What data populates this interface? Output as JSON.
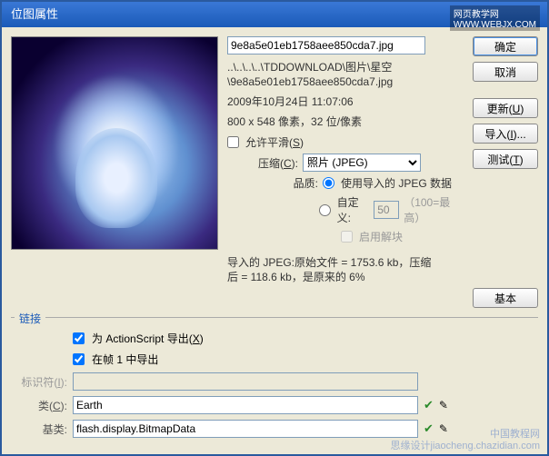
{
  "title": "位图属性",
  "watermark_site": "网页教学网",
  "watermark_url": "WWW.WEBJX.COM",
  "filename": "9e8a5e01eb1758aee850cda7.jpg",
  "path": "..\\..\\..\\..\\TDDOWNLOAD\\图片\\星空\\9e8a5e01eb1758aee850cda7.jpg",
  "datetime": "2009年10月24日  11:07:06",
  "dimensions": "800 x 548 像素，32 位/像素",
  "smoothing_label": "允许平滑(S)",
  "compression_label": "压缩(C):",
  "compression_value": "照片 (JPEG)",
  "quality_label": "品质:",
  "quality_imported": "使用导入的 JPEG 数据",
  "quality_custom": "自定义:",
  "quality_custom_value": "50",
  "quality_hint": "（100=最高）",
  "deblocking_label": "启用解块",
  "summary_line1": "导入的 JPEG:原始文件 = 1753.6 kb，压缩",
  "summary_line2": "后 = 118.6 kb，是原来的 6%",
  "buttons": {
    "ok": "确定",
    "cancel": "取消",
    "update": "更新(U)",
    "import": "导入(I)...",
    "test": "测试(T)",
    "basic": "基本"
  },
  "link": {
    "section": "链接",
    "export_as": "为 ActionScript 导出(X)",
    "export_frame1": "在帧 1 中导出",
    "identifier_label": "标识符(I):",
    "class_label": "类(C):",
    "class_value": "Earth",
    "baseclass_label": "基类:",
    "baseclass_value": "flash.display.BitmapData"
  },
  "footer_wm1": "中国教程网",
  "footer_wm2": "思缘设计jiaocheng.chazidian.com"
}
